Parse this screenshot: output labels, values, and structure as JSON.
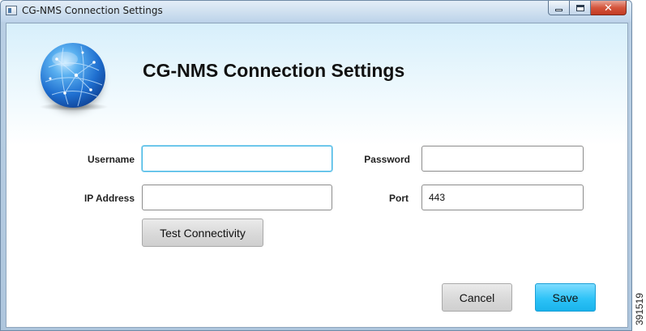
{
  "window": {
    "title": "CG-NMS Connection Settings",
    "controls": {
      "minimize": "",
      "maximize": "",
      "close": "✕"
    }
  },
  "header": {
    "title": "CG-NMS Connection Settings",
    "logo_icon": "globe-icon"
  },
  "form": {
    "username": {
      "label": "Username",
      "value": "",
      "placeholder": ""
    },
    "password": {
      "label": "Password",
      "value": "",
      "placeholder": ""
    },
    "ip_address": {
      "label": "IP Address",
      "value": "",
      "placeholder": ""
    },
    "port": {
      "label": "Port",
      "value": "443",
      "placeholder": ""
    },
    "test_button": "Test Connectivity"
  },
  "footer": {
    "cancel_label": "Cancel",
    "save_label": "Save"
  },
  "figure_id": "391519",
  "colors": {
    "primary_button": "#2ec3f7",
    "focus_border": "#3fb6e6",
    "close_button": "#d4553c"
  }
}
